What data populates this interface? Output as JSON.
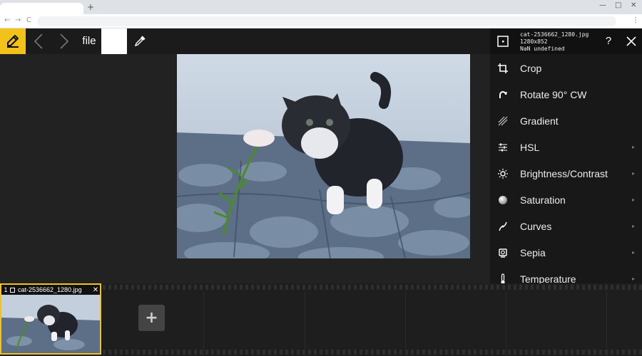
{
  "browser": {
    "new_tab_glyph": "+",
    "window_controls": [
      "—",
      "□",
      "✕"
    ],
    "nav_glyphs": [
      "←",
      "→",
      "C"
    ],
    "menu_glyph": "⋮"
  },
  "toolbar": {
    "file_label": "file",
    "brand_color": "#f2c21b",
    "swatch_color": "#ffffff",
    "icons": [
      "pencil-icon",
      "chevron-left-icon",
      "chevron-right-icon",
      "eyedropper-icon"
    ]
  },
  "panel": {
    "file": {
      "name": "cat-2536662_1280.jpg",
      "dimensions": "1280x852",
      "extra": "NaN undefined"
    },
    "help_label": "?",
    "tools": [
      {
        "label": "Crop",
        "icon": "crop-icon",
        "submenu": false
      },
      {
        "label": "Rotate 90° CW",
        "icon": "rotate-cw-icon",
        "submenu": false
      },
      {
        "label": "Gradient",
        "icon": "gradient-icon",
        "submenu": false
      },
      {
        "label": "HSL",
        "icon": "sliders-icon",
        "submenu": true
      },
      {
        "label": "Brightness/Contrast",
        "icon": "brightness-icon",
        "submenu": true
      },
      {
        "label": "Saturation",
        "icon": "saturation-icon",
        "submenu": true
      },
      {
        "label": "Curves",
        "icon": "curves-icon",
        "submenu": true
      },
      {
        "label": "Sepia",
        "icon": "sepia-icon",
        "submenu": true
      },
      {
        "label": "Temperature",
        "icon": "thermometer-icon",
        "submenu": true
      }
    ],
    "submenu_glyph": "▸"
  },
  "filmstrip": {
    "items": [
      {
        "index": "1",
        "name": "cat-2536662_1280.jpg",
        "close": "✕"
      }
    ],
    "add_label": "+",
    "accent": "#f2c21b"
  }
}
